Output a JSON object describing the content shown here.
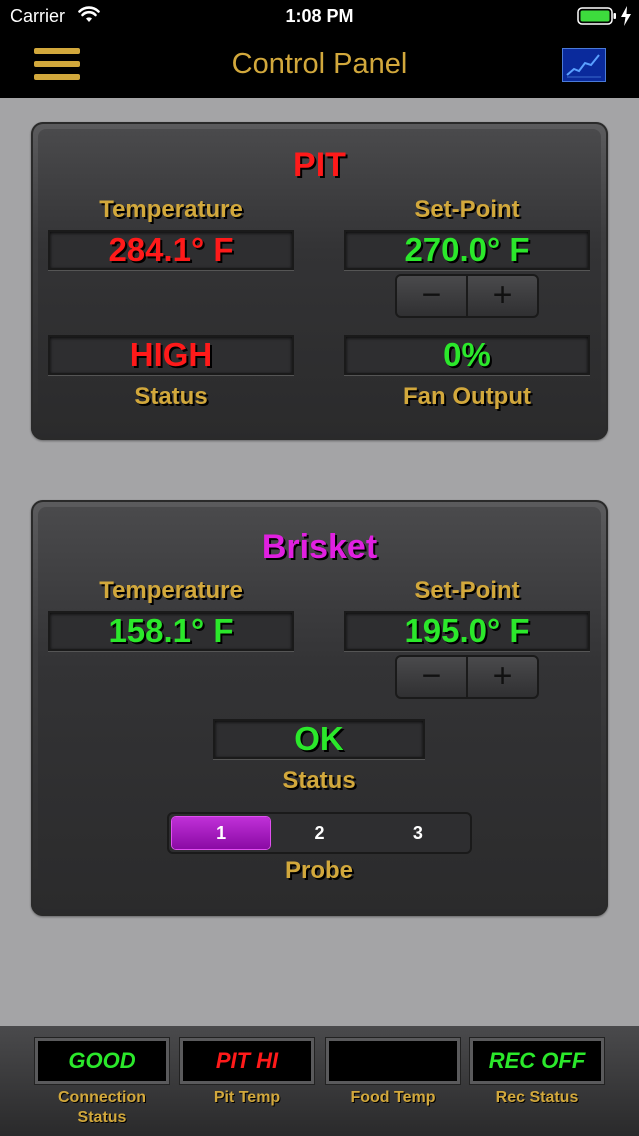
{
  "status_bar": {
    "carrier": "Carrier",
    "time": "1:08 PM"
  },
  "nav": {
    "title": "Control Panel",
    "menu_icon": "hamburger-menu-icon",
    "chart_icon": "line-chart-icon"
  },
  "pit": {
    "heading": "PIT",
    "temperature_label": "Temperature",
    "temperature_value": "284.1° F",
    "setpoint_label": "Set-Point",
    "setpoint_value": "270.0° F",
    "decrement": "−",
    "increment": "+",
    "status_value": "HIGH",
    "status_label": "Status",
    "fan_value": "0%",
    "fan_label": "Fan Output"
  },
  "food": {
    "heading": "Brisket",
    "temperature_label": "Temperature",
    "temperature_value": "158.1° F",
    "setpoint_label": "Set-Point",
    "setpoint_value": "195.0° F",
    "decrement": "−",
    "increment": "+",
    "status_value": "OK",
    "status_label": "Status",
    "probe_options": [
      "1",
      "2",
      "3"
    ],
    "probe_selected": "1",
    "probe_label": "Probe"
  },
  "toolbar": [
    {
      "value": "GOOD",
      "label": "Connection Status"
    },
    {
      "value": "PIT HI",
      "label": "Pit Temp"
    },
    {
      "value": "",
      "label": "Food Temp"
    },
    {
      "value": "REC OFF",
      "label": "Rec Status"
    }
  ],
  "colors": {
    "accent_gold": "#d2a83c",
    "alarm_red": "#ff1a1a",
    "ok_green": "#2be82b",
    "food_magenta": "#e020e0",
    "chart_blue": "#0a2a9c"
  }
}
